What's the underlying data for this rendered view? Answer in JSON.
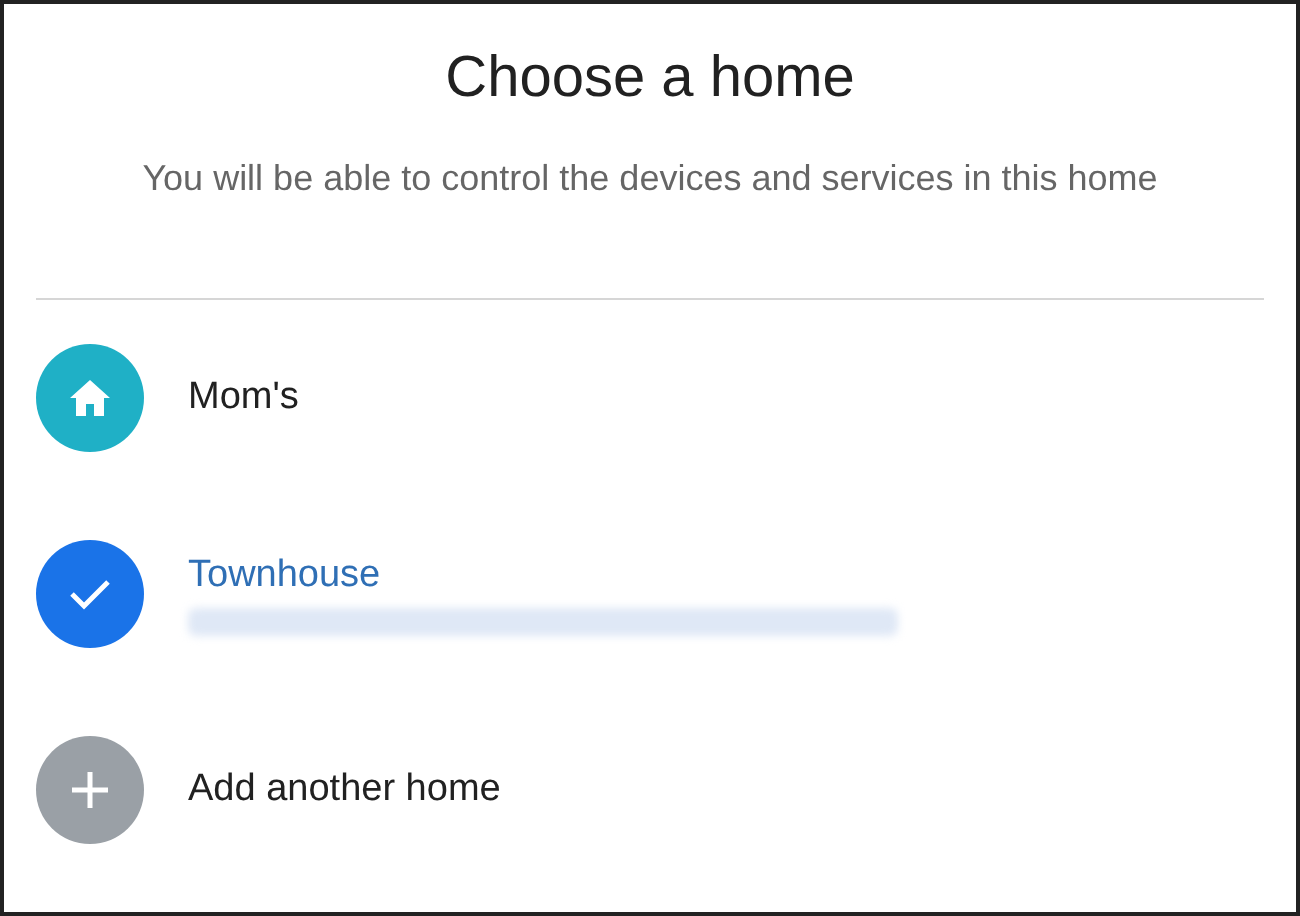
{
  "title": "Choose a home",
  "subtitle": "You will be able to control the devices and services in this home",
  "homes": [
    {
      "kind": "home",
      "name": "Mom's",
      "selected": false,
      "address_redacted": false
    },
    {
      "kind": "home",
      "name": "Townhouse",
      "selected": true,
      "address_redacted": true
    },
    {
      "kind": "add",
      "name": "Add another home"
    }
  ]
}
